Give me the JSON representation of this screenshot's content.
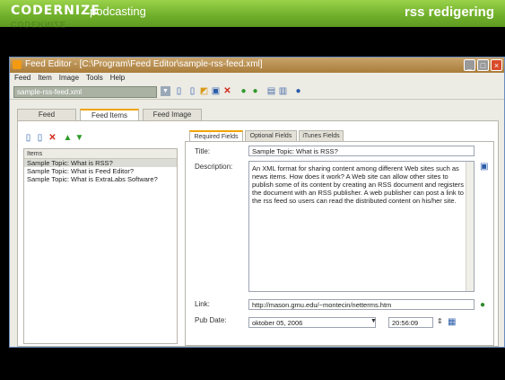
{
  "slide": {
    "brand": "CODERNIZE",
    "brand_suffix": "podcasting",
    "brand_reflection": "CODERNIZE",
    "title": "rss redigering"
  },
  "window": {
    "title": "Feed Editor - [C:\\Program\\Feed Editor\\sample-rss-feed.xml]",
    "controls": {
      "minimize": "_",
      "maximize": "□",
      "close": "×"
    },
    "menu": [
      "Feed",
      "Item",
      "Image",
      "Tools",
      "Help"
    ],
    "toolbar": {
      "feed_select_value": "sample-rss-feed.xml",
      "icons": [
        "dropdown-arrow-icon",
        "new-document-icon",
        "new-file-icon",
        "open-folder-icon",
        "save-icon",
        "delete-icon",
        "green-circle-icon",
        "green-circle-icon",
        "preview-icon",
        "search-icon",
        "info-icon"
      ]
    },
    "main_tabs": [
      "Feed",
      "Feed Items",
      "Feed Image"
    ],
    "main_tabs_active": 1,
    "items_panel": {
      "header": "Items",
      "items": [
        "Sample Topic: What is RSS?",
        "Sample Topic: What is Feed Editor?",
        "Sample Topic: What is ExtraLabs Software?"
      ],
      "selected_index": 0,
      "toolbar_icons": [
        "new-item-icon",
        "copy-item-icon",
        "delete-item-icon",
        "move-up-icon",
        "move-down-icon"
      ]
    },
    "sub_tabs": [
      "Required Fields",
      "Optional Fields",
      "iTunes Fields"
    ],
    "sub_tabs_active": 0,
    "form": {
      "title_label": "Title:",
      "title_value": "Sample Topic: What is RSS?",
      "description_label": "Description:",
      "description_value": "An XML format for sharing content among different Web sites such as news items. How does it work? A Web site can allow other sites to publish some of its content by creating an RSS document and registers the document with an RSS publisher. A web publisher can post a link to the rss feed so users can read the distributed content on his/her site.",
      "link_label": "Link:",
      "link_value": "http://mason.gmu.edu/~montecin/netterms.htm",
      "pubdate_label": "Pub Date:",
      "pubdate_date": "oktober  05, 2006",
      "pubdate_time": "20:56:09"
    }
  },
  "colors": {
    "header_green": "#7bbf34",
    "tab_accent": "#f0a400",
    "close_red": "#d84b2a"
  }
}
